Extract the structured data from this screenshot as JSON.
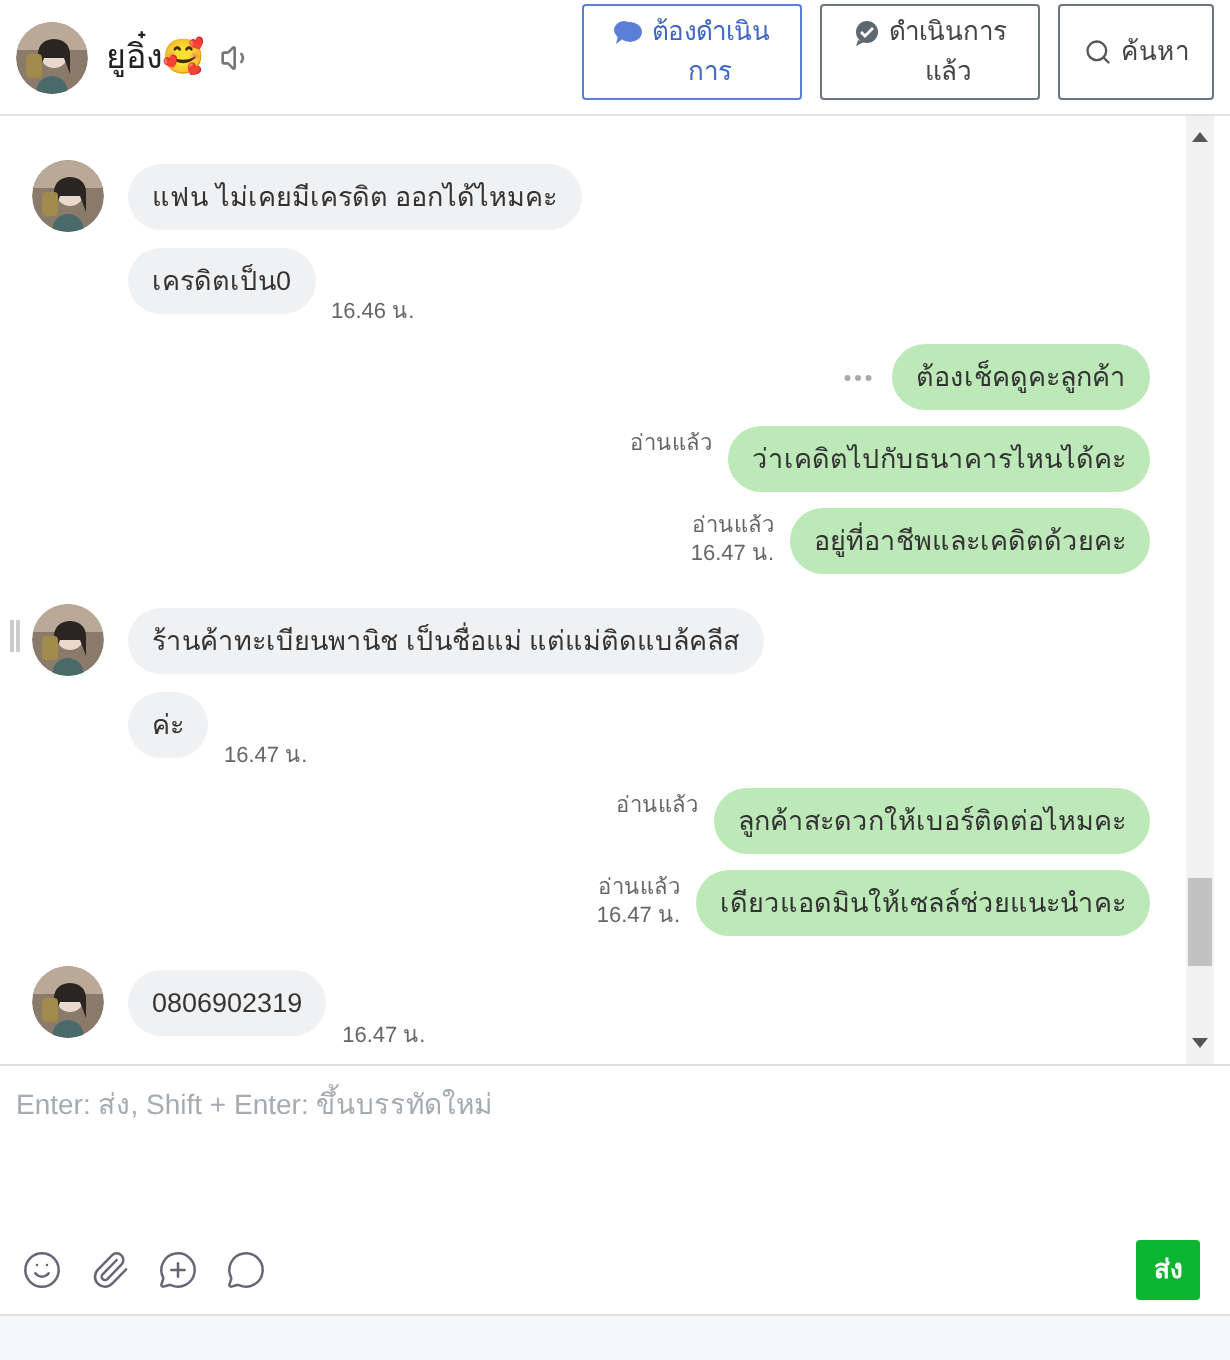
{
  "header": {
    "name": "ยูอิ๋ง🥰",
    "buttons": [
      {
        "label_lines": [
          "ต้องดำเนิน",
          "การ"
        ],
        "kind": "todo",
        "selected": true
      },
      {
        "label_lines": [
          "ดำเนินการ",
          "แล้ว"
        ],
        "kind": "done",
        "selected": false
      },
      {
        "label_lines": [
          "ค้นหา"
        ],
        "kind": "search",
        "selected": false
      }
    ]
  },
  "messages": [
    {
      "kind": "incoming",
      "avatar": true,
      "text": "แฟน ไม่เคยมีเครดิต ออกได้ไหมคะ"
    },
    {
      "kind": "incoming",
      "avatar": false,
      "text": "เครดิตเป็น0",
      "time": "16.46 น."
    },
    {
      "kind": "outgoing",
      "text": "ต้องเช็คดูคะลูกค้า",
      "more": true
    },
    {
      "kind": "outgoing",
      "text": "ว่าเคดิตไปกับธนาคารไหนได้คะ",
      "status": "อ่านแล้ว"
    },
    {
      "kind": "outgoing",
      "text": "อยู่ที่อาชีพและเคดิตด้วยคะ",
      "status": "อ่านแล้ว",
      "time": "16.47 น."
    },
    {
      "kind": "incoming",
      "avatar": true,
      "handle": true,
      "text": "ร้านค้าทะเบียนพานิช เป็นชื่อแม่ แต่แม่ติดแบล้คลีส"
    },
    {
      "kind": "incoming",
      "avatar": false,
      "text": "ค่ะ",
      "time": "16.47 น."
    },
    {
      "kind": "outgoing",
      "text": "ลูกค้าสะดวกให้เบอร์ติดต่อไหมคะ",
      "status": "อ่านแล้ว"
    },
    {
      "kind": "outgoing",
      "text": "เดียวแอดมินให้เซลล์ช่วยแนะนำคะ",
      "status": "อ่านแล้ว",
      "time": "16.47 น."
    },
    {
      "kind": "incoming",
      "avatar": true,
      "text": "0806902319",
      "time": "16.47 น."
    }
  ],
  "composer": {
    "placeholder": "Enter: ส่ง, Shift + Enter: ขึ้นบรรทัดใหม่",
    "send": "ส่ง"
  }
}
